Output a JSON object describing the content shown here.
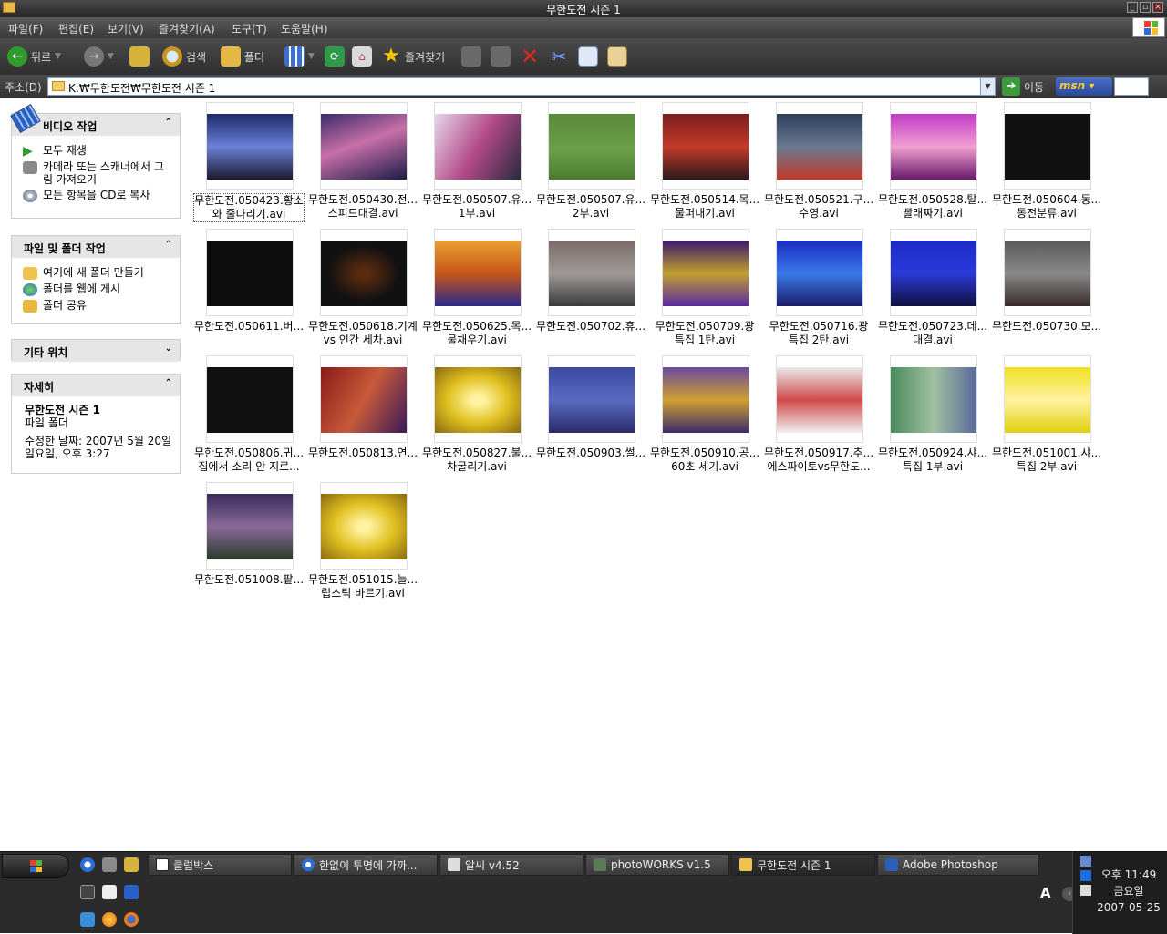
{
  "window": {
    "title": "무한도전 시즌 1"
  },
  "menu": [
    "파일(F)",
    "편집(E)",
    "보기(V)",
    "즐겨찾기(A)",
    "도구(T)",
    "도움말(H)"
  ],
  "toolbar": {
    "back": "뒤로",
    "search": "검색",
    "folders": "폴더",
    "favorites": "즐겨찾기"
  },
  "address": {
    "label": "주소(D)",
    "path": "K:₩무한도전₩무한도전 시즌 1",
    "go": "이동",
    "msn": "msn"
  },
  "tasks": {
    "video": {
      "title": "비디오 작업",
      "items": [
        "모두 재생",
        "카메라 또는 스캐너에서 그림 가져오기",
        "모든 항목을 CD로 복사"
      ]
    },
    "file": {
      "title": "파일 및 폴더 작업",
      "items": [
        "여기에 새 폴더 만들기",
        "폴더를 웹에 게시",
        "폴더 공유"
      ]
    },
    "other": {
      "title": "기타 위치"
    },
    "details": {
      "title": "자세히",
      "name": "무한도전 시즌 1",
      "type": "파일 폴더",
      "modified": "수정한 날짜: 2007년 5월 20일 일요일, 오후 3:27"
    }
  },
  "files": [
    {
      "line1": "무한도전.050423.황소",
      "line2": "와 줄다리기.avi"
    },
    {
      "line1": "무한도전.050430.전...",
      "line2": "스피드대결.avi"
    },
    {
      "line1": "무한도전.050507.유...",
      "line2": "1부.avi"
    },
    {
      "line1": "무한도전.050507.유...",
      "line2": "2부.avi"
    },
    {
      "line1": "무한도전.050514.목...",
      "line2": "물퍼내기.avi"
    },
    {
      "line1": "무한도전.050521.구...",
      "line2": "수영.avi"
    },
    {
      "line1": "무한도전.050528.탈...",
      "line2": "빨래짜기.avi"
    },
    {
      "line1": "무한도전.050604.동...",
      "line2": "동전분류.avi"
    },
    {
      "line1": "무한도전.050611.버...",
      "line2": ""
    },
    {
      "line1": "무한도전.050618.기계",
      "line2": "vs 인간 세차.avi"
    },
    {
      "line1": "무한도전.050625.목...",
      "line2": "물채우기.avi"
    },
    {
      "line1": "무한도전.050702.휴...",
      "line2": ""
    },
    {
      "line1": "무한도전.050709.광",
      "line2": "특집 1탄.avi"
    },
    {
      "line1": "무한도전.050716.광",
      "line2": "특집 2탄.avi"
    },
    {
      "line1": "무한도전.050723.데...",
      "line2": "대결.avi"
    },
    {
      "line1": "무한도전.050730.모...",
      "line2": ""
    },
    {
      "line1": "무한도전.050806.귀...",
      "line2": "집에서 소리 안 지르..."
    },
    {
      "line1": "무한도전.050813.연...",
      "line2": ""
    },
    {
      "line1": "무한도전.050827.불...",
      "line2": "차굴리기.avi"
    },
    {
      "line1": "무한도전.050903.썰...",
      "line2": ""
    },
    {
      "line1": "무한도전.050910.공...",
      "line2": "60초 세기.avi"
    },
    {
      "line1": "무한도전.050917.추...",
      "line2": "에스파이토vs무한도..."
    },
    {
      "line1": "무한도전.050924.샤...",
      "line2": "특집 1부.avi"
    },
    {
      "line1": "무한도전.051001.샤...",
      "line2": "특집 2부.avi"
    },
    {
      "line1": "무한도전.051008.팥...",
      "line2": ""
    },
    {
      "line1": "무한도전.051015.늘...",
      "line2": "립스틱 바르기.avi"
    }
  ],
  "taskbar": {
    "buttons": [
      "클럽박스",
      "한없이 투명에 가까...",
      "알씨 v4.52",
      "photoWORKS v1.5",
      "무한도전 시즌 1",
      "Adobe Photoshop"
    ],
    "lang": "A",
    "clock": {
      "time": "오후 11:49",
      "day": "금요일",
      "date": "2007-05-25"
    }
  }
}
